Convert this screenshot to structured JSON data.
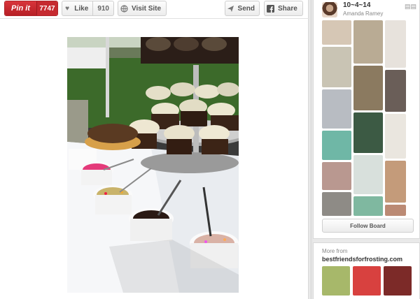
{
  "toolbar": {
    "pinit_label": "Pin it",
    "pinit_count": "7747",
    "like_label": "Like",
    "like_count": "910",
    "visit_label": "Visit Site",
    "send_label": "Send",
    "share_label": "Share"
  },
  "board": {
    "title": "10~4~14",
    "owner": "Amanda Ramey",
    "follow_label": "Follow Board"
  },
  "more": {
    "label": "More from",
    "source": "bestfriendsforfrosting.com"
  },
  "colors": {
    "pinit_red": "#c62a30",
    "link_text": "#333333"
  }
}
